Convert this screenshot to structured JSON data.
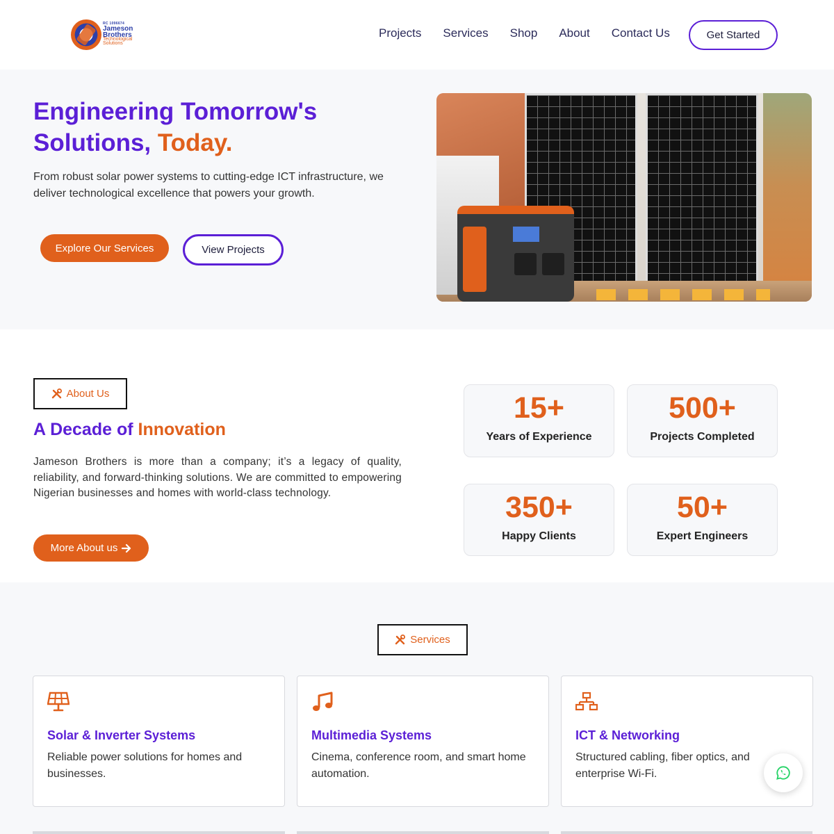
{
  "header": {
    "logo": {
      "small_text": "RC 1096674",
      "name": "Jameson Brothers",
      "tagline": "Technological Solutions"
    },
    "nav": [
      {
        "label": "Projects"
      },
      {
        "label": "Services"
      },
      {
        "label": "Shop"
      },
      {
        "label": "About"
      },
      {
        "label": "Contact Us"
      }
    ],
    "cta_label": "Get Started"
  },
  "hero": {
    "title_line1": "Engineering Tomorrow's",
    "title_line2_purple": "Solutions,",
    "title_line2_orange": "Today.",
    "description": "From robust solar power systems to cutting-edge ICT infrastructure, we deliver technological excellence that powers your growth.",
    "primary_button": "Explore Our Services",
    "secondary_button": "View Projects"
  },
  "about": {
    "tag_label": "About Us",
    "title_purple": "A Decade of",
    "title_orange": "Innovation",
    "text": "Jameson Brothers is more than a company; it’s a legacy of quality, reliability, and forward-thinking solutions. We are committed to empowering Nigerian businesses and homes with world-class technology.",
    "button": "More About us",
    "stats": [
      {
        "value": "15+",
        "label": "Years of Experience"
      },
      {
        "value": "500+",
        "label": "Projects Completed"
      },
      {
        "value": "350+",
        "label": "Happy Clients"
      },
      {
        "value": "50+",
        "label": "Expert Engineers"
      }
    ]
  },
  "services": {
    "tag_label": "Services",
    "cards": [
      {
        "icon": "solar-panel-icon",
        "title": "Solar & Inverter Systems",
        "text": "Reliable power solutions for homes and businesses."
      },
      {
        "icon": "music-note-icon",
        "title": "Multimedia Systems",
        "text": "Cinema, conference room, and smart home automation."
      },
      {
        "icon": "network-icon",
        "title": "ICT & Networking",
        "text": "Structured cabling, fiber optics, and enterprise Wi-Fi."
      }
    ]
  },
  "colors": {
    "primary": "#5b1fd6",
    "accent": "#e0601c",
    "whatsapp": "#25d366"
  },
  "floating": {
    "icon": "whatsapp-icon"
  }
}
